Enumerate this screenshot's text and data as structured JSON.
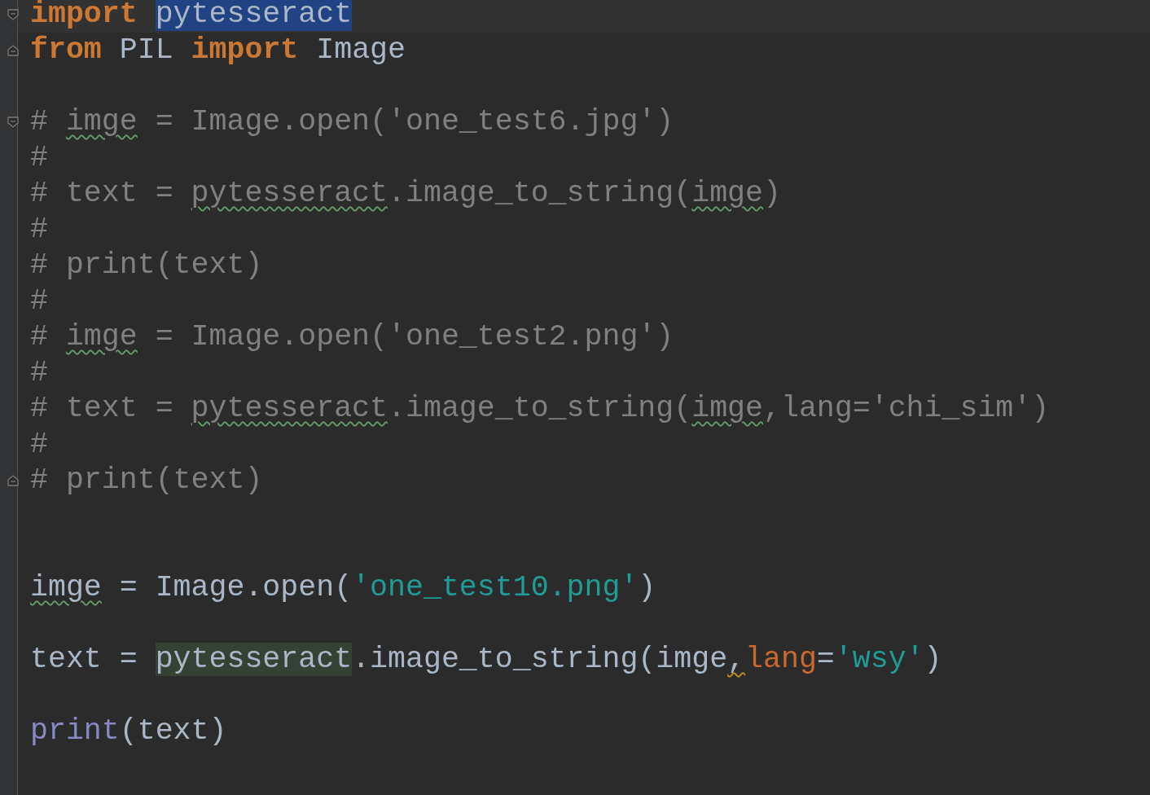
{
  "lines": [
    {
      "current": true,
      "fold_start": true,
      "tokens": [
        {
          "text": "import ",
          "kind": "keyword"
        },
        {
          "text": "pytesseract",
          "kind": "plain",
          "selected": true
        }
      ]
    },
    {
      "fold_end": true,
      "tokens": [
        {
          "text": "from",
          "kind": "keyword"
        },
        {
          "text": " PIL ",
          "kind": "plain"
        },
        {
          "text": "import",
          "kind": "keyword"
        },
        {
          "text": " Image",
          "kind": "plain"
        }
      ]
    },
    {
      "blank": true
    },
    {
      "fold_start": true,
      "tokens": [
        {
          "text": "# ",
          "kind": "comment"
        },
        {
          "text": "imge",
          "kind": "comment",
          "misspelled": true
        },
        {
          "text": " = Image.open('one_test6.jpg')",
          "kind": "comment"
        }
      ]
    },
    {
      "tokens": [
        {
          "text": "#",
          "kind": "comment"
        }
      ]
    },
    {
      "tokens": [
        {
          "text": "# text = ",
          "kind": "comment"
        },
        {
          "text": "pytesseract",
          "kind": "comment",
          "misspelled": true
        },
        {
          "text": ".image_to_string(",
          "kind": "comment"
        },
        {
          "text": "imge",
          "kind": "comment",
          "misspelled": true
        },
        {
          "text": ")",
          "kind": "comment"
        }
      ]
    },
    {
      "tokens": [
        {
          "text": "#",
          "kind": "comment"
        }
      ]
    },
    {
      "tokens": [
        {
          "text": "# print(text)",
          "kind": "comment"
        }
      ]
    },
    {
      "tokens": [
        {
          "text": "#",
          "kind": "comment"
        }
      ]
    },
    {
      "tokens": [
        {
          "text": "# ",
          "kind": "comment"
        },
        {
          "text": "imge",
          "kind": "comment",
          "misspelled": true
        },
        {
          "text": " = Image.open('one_test2.png')",
          "kind": "comment"
        }
      ]
    },
    {
      "tokens": [
        {
          "text": "#",
          "kind": "comment"
        }
      ]
    },
    {
      "tokens": [
        {
          "text": "# text = ",
          "kind": "comment"
        },
        {
          "text": "pytesseract",
          "kind": "comment",
          "misspelled": true
        },
        {
          "text": ".image_to_string(",
          "kind": "comment"
        },
        {
          "text": "imge",
          "kind": "comment",
          "misspelled": true
        },
        {
          "text": ",lang='chi_sim')",
          "kind": "comment"
        }
      ]
    },
    {
      "tokens": [
        {
          "text": "#",
          "kind": "comment"
        }
      ]
    },
    {
      "fold_end": true,
      "tokens": [
        {
          "text": "# print(text)",
          "kind": "comment"
        }
      ]
    },
    {
      "blank": true
    },
    {
      "blank": true
    },
    {
      "tokens": [
        {
          "text": "imge",
          "kind": "plain",
          "misspelled": true
        },
        {
          "text": " = Image.open(",
          "kind": "plain"
        },
        {
          "text": "'one_test10.png'",
          "kind": "string"
        },
        {
          "text": ")",
          "kind": "plain"
        }
      ]
    },
    {
      "blank": true
    },
    {
      "tokens": [
        {
          "text": "text = ",
          "kind": "plain"
        },
        {
          "text": "pytesseract",
          "kind": "plain",
          "usage_highlight": true
        },
        {
          "text": ".image_to_string(imge",
          "kind": "plain"
        },
        {
          "text": ",",
          "kind": "plain",
          "warning": true
        },
        {
          "text": "lang",
          "kind": "param"
        },
        {
          "text": "=",
          "kind": "plain"
        },
        {
          "text": "'wsy'",
          "kind": "string"
        },
        {
          "text": ")",
          "kind": "plain"
        }
      ]
    },
    {
      "blank": true
    },
    {
      "tokens": [
        {
          "text": "print",
          "kind": "builtin"
        },
        {
          "text": "(text)",
          "kind": "plain"
        }
      ]
    }
  ]
}
